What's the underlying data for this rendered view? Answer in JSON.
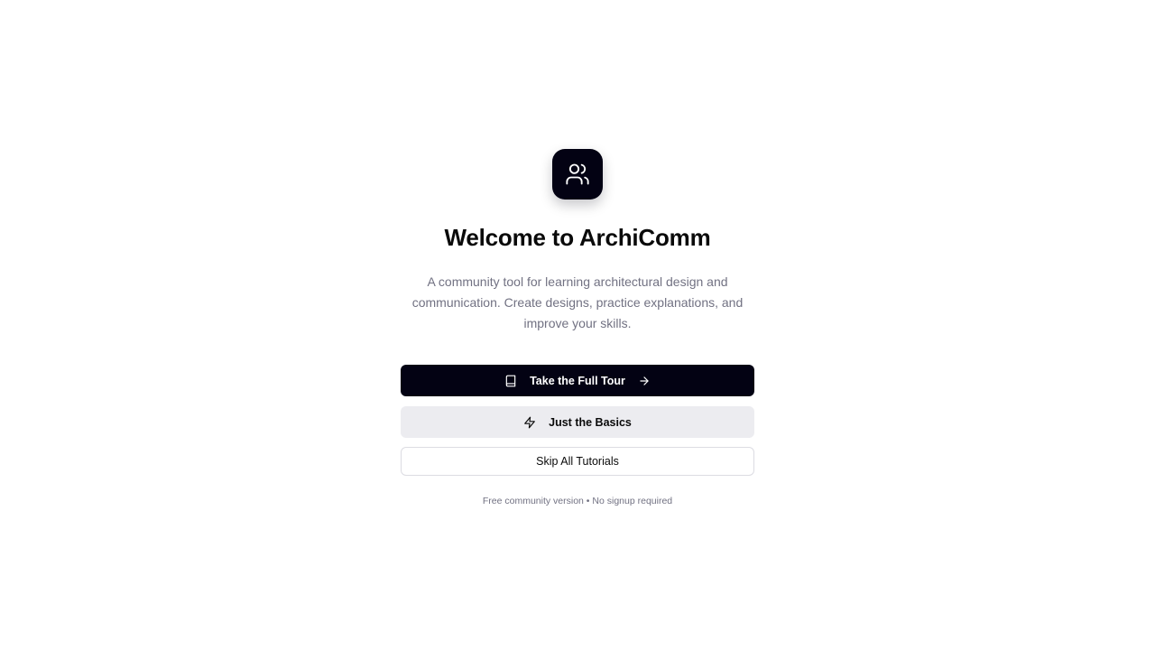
{
  "app": {
    "title": "Welcome to ArchiComm",
    "logo_icon": "users-icon",
    "description": "A community tool for learning architectural design and communication. Create designs, practice explanations, and improve your skills."
  },
  "actions": {
    "full_tour": {
      "label": "Take the Full Tour",
      "icon": "book-icon",
      "trailing_icon": "arrow-right-icon"
    },
    "basics": {
      "label": "Just the Basics",
      "icon": "zap-icon"
    },
    "skip": {
      "label": "Skip All Tutorials"
    }
  },
  "footnote": "Free community version • No signup required",
  "colors": {
    "primary": "#030213",
    "secondary_bg": "#ececf0",
    "muted_text": "#717182",
    "border": "#dcdce2"
  }
}
